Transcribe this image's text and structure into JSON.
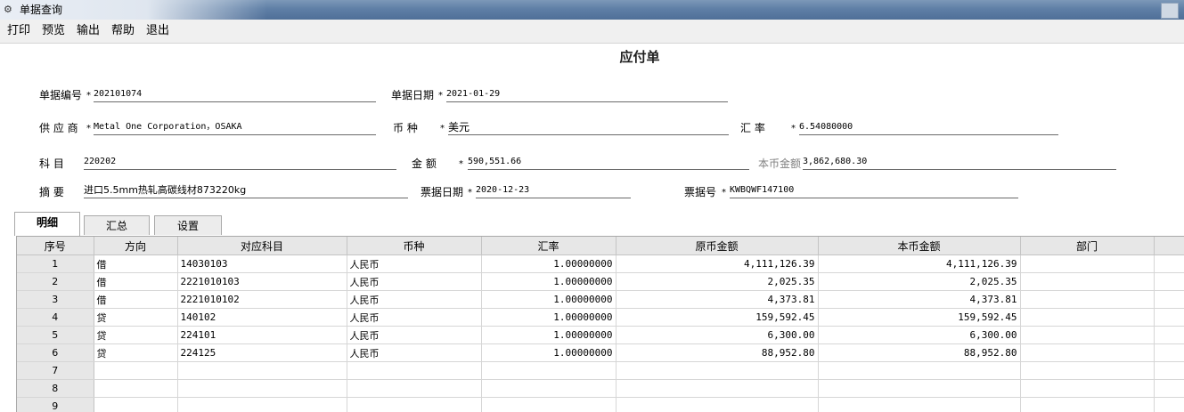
{
  "window": {
    "title": "单据查询"
  },
  "menu": [
    "打印",
    "预览",
    "输出",
    "帮助",
    "退出"
  ],
  "document": {
    "title": "应付单"
  },
  "form": {
    "doc_no": {
      "label": "单据编号",
      "value": "202101074"
    },
    "doc_date": {
      "label": "单据日期",
      "value": "2021-01-29"
    },
    "supplier": {
      "label": "供 应 商",
      "value": "Metal  One  Corporation，OSAKA"
    },
    "currency": {
      "label": "币    种",
      "value": "美元"
    },
    "rate": {
      "label": "汇    率",
      "value": "6.54080000"
    },
    "account": {
      "label": "科    目",
      "value": "220202"
    },
    "amount": {
      "label": "金    额",
      "value": "590,551.66"
    },
    "local_amount": {
      "label": "本币金额",
      "value": "3,862,680.30"
    },
    "summary": {
      "label": "摘    要",
      "value": "进口5.5mm热轧高碳线材873220kg"
    },
    "bill_date": {
      "label": "票据日期",
      "value": "2020-12-23"
    },
    "bill_no": {
      "label": "票据号",
      "value": "KWBQWF147100"
    },
    "required_mark": "*"
  },
  "tabs": [
    "明细",
    "汇总",
    "设置"
  ],
  "grid": {
    "columns": [
      "序号",
      "方向",
      "对应科目",
      "币种",
      "汇率",
      "原币金额",
      "本币金额",
      "部门"
    ],
    "rows": [
      {
        "no": "1",
        "dir": "借",
        "account": "14030103",
        "currency": "人民币",
        "rate": "1.00000000",
        "orig": "4,111,126.39",
        "local": "4,111,126.39",
        "dept": ""
      },
      {
        "no": "2",
        "dir": "借",
        "account": "2221010103",
        "currency": "人民币",
        "rate": "1.00000000",
        "orig": "2,025.35",
        "local": "2,025.35",
        "dept": ""
      },
      {
        "no": "3",
        "dir": "借",
        "account": "2221010102",
        "currency": "人民币",
        "rate": "1.00000000",
        "orig": "4,373.81",
        "local": "4,373.81",
        "dept": ""
      },
      {
        "no": "4",
        "dir": "贷",
        "account": "140102",
        "currency": "人民币",
        "rate": "1.00000000",
        "orig": "159,592.45",
        "local": "159,592.45",
        "dept": ""
      },
      {
        "no": "5",
        "dir": "贷",
        "account": "224101",
        "currency": "人民币",
        "rate": "1.00000000",
        "orig": "6,300.00",
        "local": "6,300.00",
        "dept": ""
      },
      {
        "no": "6",
        "dir": "贷",
        "account": "224125",
        "currency": "人民币",
        "rate": "1.00000000",
        "orig": "88,952.80",
        "local": "88,952.80",
        "dept": ""
      },
      {
        "no": "7",
        "dir": "",
        "account": "",
        "currency": "",
        "rate": "",
        "orig": "",
        "local": "",
        "dept": ""
      },
      {
        "no": "8",
        "dir": "",
        "account": "",
        "currency": "",
        "rate": "",
        "orig": "",
        "local": "",
        "dept": ""
      },
      {
        "no": "9",
        "dir": "",
        "account": "",
        "currency": "",
        "rate": "",
        "orig": "",
        "local": "",
        "dept": ""
      }
    ]
  }
}
